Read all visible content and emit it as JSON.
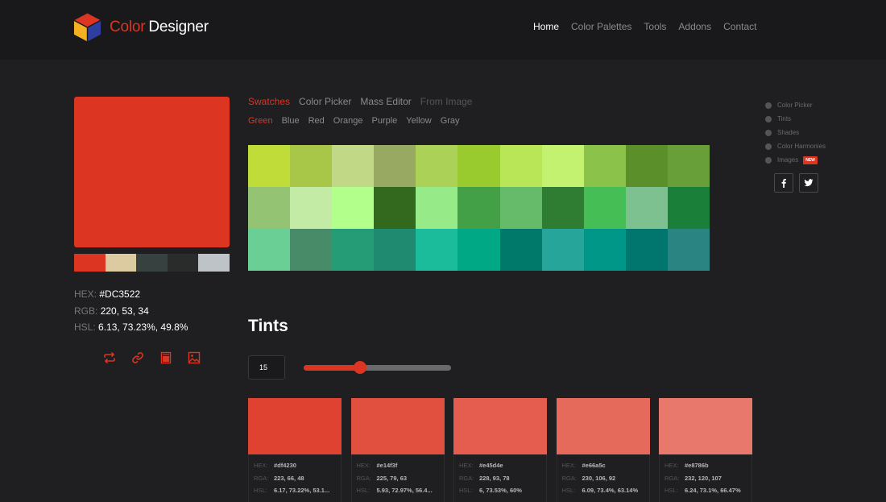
{
  "header": {
    "brand_part1": "Color",
    "brand_part2": "Designer",
    "nav": [
      {
        "label": "Home",
        "active": true
      },
      {
        "label": "Color Palettes",
        "active": false
      },
      {
        "label": "Tools",
        "active": false
      },
      {
        "label": "Addons",
        "active": false
      },
      {
        "label": "Contact",
        "active": false
      }
    ]
  },
  "selected_color": {
    "hex_color": "#DC3522",
    "hex_label": "HEX:",
    "hex_value": "#DC3522",
    "rgb_label": "RGB:",
    "rgb_value": "220, 53, 34",
    "hsl_label": "HSL:",
    "hsl_value": "6.13, 73.23%, 49.8%",
    "palette": [
      "#dc3522",
      "#dccba0",
      "#374140",
      "#2a2c2b",
      "#bdc3c7"
    ],
    "actions": [
      "swap-icon",
      "link-icon",
      "save-icon",
      "image-icon"
    ]
  },
  "tabs": [
    {
      "label": "Swatches",
      "state": "active"
    },
    {
      "label": "Color Picker",
      "state": "normal"
    },
    {
      "label": "Mass Editor",
      "state": "normal"
    },
    {
      "label": "From Image",
      "state": "disabled"
    }
  ],
  "subtabs": [
    {
      "label": "Green",
      "active": true
    },
    {
      "label": "Blue",
      "active": false
    },
    {
      "label": "Red",
      "active": false
    },
    {
      "label": "Orange",
      "active": false
    },
    {
      "label": "Purple",
      "active": false
    },
    {
      "label": "Yellow",
      "active": false
    },
    {
      "label": "Gray",
      "active": false
    }
  ],
  "swatches": [
    "#c0dc38",
    "#a8c647",
    "#c1d887",
    "#98aa62",
    "#abd157",
    "#9acb2e",
    "#b8e657",
    "#c2f26f",
    "#8bc34a",
    "#5a8f29",
    "#689f38",
    "#94c373",
    "#c4eba6",
    "#b2ff8c",
    "#33691e",
    "#96eb88",
    "#43a047",
    "#66bb6a",
    "#2e7d32",
    "#45be56",
    "#7dc191",
    "#1a8039",
    "#69cf95",
    "#478b69",
    "#259b76",
    "#208a70",
    "#1abc9c",
    "#00a886",
    "#00796b",
    "#26a69a",
    "#009688",
    "#00766f",
    "#2a8482"
  ],
  "side_links": [
    {
      "label": "Color Picker",
      "badge": ""
    },
    {
      "label": "Tints",
      "badge": ""
    },
    {
      "label": "Shades",
      "badge": ""
    },
    {
      "label": "Color Harmonies",
      "badge": ""
    },
    {
      "label": "Images",
      "badge": "NEW"
    }
  ],
  "social": [
    "facebook-icon",
    "twitter-icon"
  ],
  "tints": {
    "title": "Tints",
    "step_value": "15",
    "slider_fraction": 0.38,
    "labels": {
      "hex": "HEX:",
      "rgb": "RGA:",
      "hsl": "HSL:"
    },
    "items": [
      {
        "color": "#df4230",
        "hex": "#df4230",
        "rgb": "223, 66, 48",
        "hsl": "6.17, 73.22%, 53.1..."
      },
      {
        "color": "#e14f3f",
        "hex": "#e14f3f",
        "rgb": "225, 79, 63",
        "hsl": "5.93, 72.97%, 56.4..."
      },
      {
        "color": "#e45d4e",
        "hex": "#e45d4e",
        "rgb": "228, 93, 78",
        "hsl": "6, 73.53%, 60%"
      },
      {
        "color": "#e66a5c",
        "hex": "#e66a5c",
        "rgb": "230, 106, 92",
        "hsl": "6.09, 73.4%, 63.14%"
      },
      {
        "color": "#e8786b",
        "hex": "#e8786b",
        "rgb": "232, 120, 107",
        "hsl": "6.24, 73.1%, 66.47%"
      }
    ]
  }
}
